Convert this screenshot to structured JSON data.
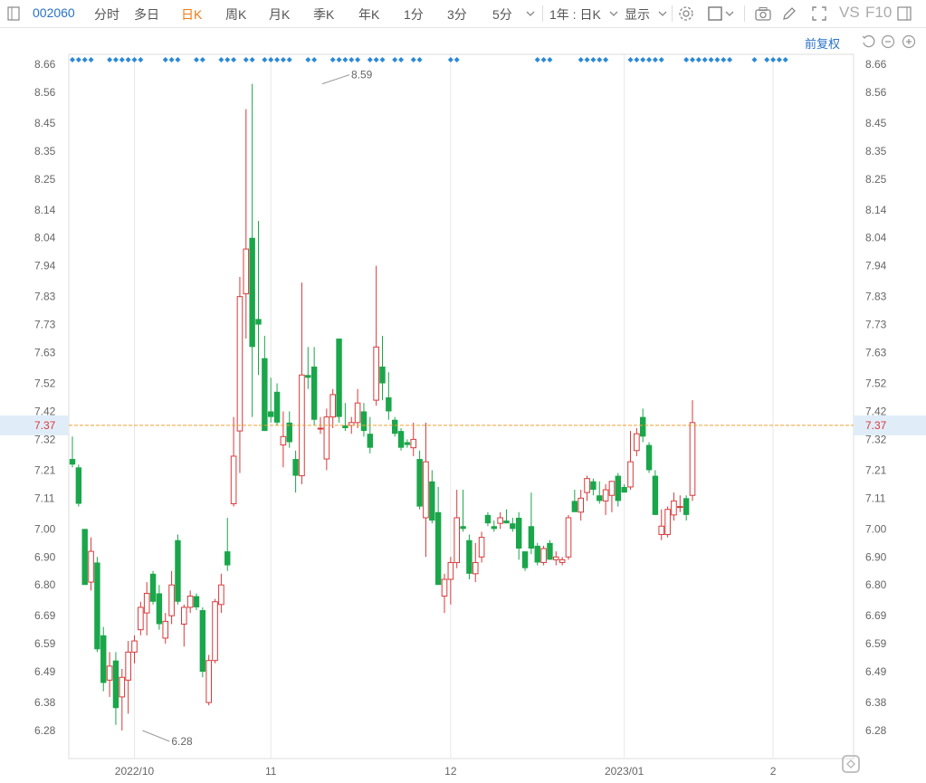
{
  "toolbar": {
    "code": "002060",
    "tabs": [
      "分时",
      "多日",
      "日K",
      "周K",
      "月K",
      "季K",
      "年K",
      "1分",
      "3分",
      "5分"
    ],
    "active_tab": "日K",
    "period_select": "1年 : 日K",
    "display_select": "显示",
    "vs_label": "VS",
    "f10_label": "F10"
  },
  "fuquan_label": "前复权",
  "current_price_label": "7.37",
  "colors": {
    "up": "#d9393a",
    "down": "#1aa64a",
    "price_line": "#f0a030",
    "marker": "#2a88d8",
    "grid": "#e8e8e8"
  },
  "chart_data": {
    "type": "candlestick",
    "y_ticks": [
      "8.66",
      "8.56",
      "8.45",
      "8.35",
      "8.25",
      "8.14",
      "8.04",
      "7.94",
      "7.83",
      "7.73",
      "7.63",
      "7.52",
      "7.42",
      "7.32",
      "7.21",
      "7.11",
      "7.00",
      "6.90",
      "6.80",
      "6.69",
      "6.59",
      "6.49",
      "6.38",
      "6.28"
    ],
    "ylim": [
      6.28,
      8.66
    ],
    "x_labels": [
      {
        "label": "2022/10",
        "index": 10
      },
      {
        "label": "11",
        "index": 32
      },
      {
        "label": "12",
        "index": 61
      },
      {
        "label": "2023/01",
        "index": 89
      },
      {
        "label": "2",
        "index": 113
      }
    ],
    "current_price": 7.37,
    "annotations": [
      {
        "text": "8.59",
        "index": 40,
        "value": 8.59
      },
      {
        "text": "6.28",
        "index": 11,
        "value": 6.28
      }
    ],
    "candles": [
      {
        "o": 7.25,
        "h": 7.33,
        "l": 7.22,
        "c": 7.23
      },
      {
        "o": 7.22,
        "h": 7.23,
        "l": 7.08,
        "c": 7.09
      },
      {
        "o": 7.0,
        "h": 7.0,
        "l": 6.8,
        "c": 6.8
      },
      {
        "o": 6.81,
        "h": 6.97,
        "l": 6.78,
        "c": 6.92
      },
      {
        "o": 6.88,
        "h": 6.9,
        "l": 6.56,
        "c": 6.57
      },
      {
        "o": 6.62,
        "h": 6.65,
        "l": 6.42,
        "c": 6.45
      },
      {
        "o": 6.46,
        "h": 6.56,
        "l": 6.4,
        "c": 6.51
      },
      {
        "o": 6.53,
        "h": 6.56,
        "l": 6.3,
        "c": 6.36
      },
      {
        "o": 6.4,
        "h": 6.5,
        "l": 6.28,
        "c": 6.47
      },
      {
        "o": 6.46,
        "h": 6.6,
        "l": 6.34,
        "c": 6.56
      },
      {
        "o": 6.56,
        "h": 6.62,
        "l": 6.52,
        "c": 6.6
      },
      {
        "o": 6.64,
        "h": 6.74,
        "l": 6.62,
        "c": 6.72
      },
      {
        "o": 6.7,
        "h": 6.81,
        "l": 6.62,
        "c": 6.77
      },
      {
        "o": 6.84,
        "h": 6.85,
        "l": 6.73,
        "c": 6.74
      },
      {
        "o": 6.77,
        "h": 6.8,
        "l": 6.64,
        "c": 6.66
      },
      {
        "o": 6.61,
        "h": 6.7,
        "l": 6.59,
        "c": 6.67
      },
      {
        "o": 6.69,
        "h": 6.85,
        "l": 6.66,
        "c": 6.8
      },
      {
        "o": 6.96,
        "h": 6.98,
        "l": 6.73,
        "c": 6.74
      },
      {
        "o": 6.66,
        "h": 6.73,
        "l": 6.58,
        "c": 6.72
      },
      {
        "o": 6.72,
        "h": 6.78,
        "l": 6.7,
        "c": 6.76
      },
      {
        "o": 6.76,
        "h": 6.77,
        "l": 6.71,
        "c": 6.72
      },
      {
        "o": 6.71,
        "h": 6.72,
        "l": 6.47,
        "c": 6.49
      },
      {
        "o": 6.38,
        "h": 6.55,
        "l": 6.37,
        "c": 6.53
      },
      {
        "o": 6.53,
        "h": 6.75,
        "l": 6.52,
        "c": 6.74
      },
      {
        "o": 6.73,
        "h": 6.84,
        "l": 6.7,
        "c": 6.8
      },
      {
        "o": 6.92,
        "h": 7.04,
        "l": 6.85,
        "c": 6.87
      },
      {
        "o": 7.09,
        "h": 7.4,
        "l": 7.08,
        "c": 7.26
      },
      {
        "o": 7.35,
        "h": 7.9,
        "l": 7.2,
        "c": 7.83
      },
      {
        "o": 7.84,
        "h": 8.5,
        "l": 7.68,
        "c": 8.0
      },
      {
        "o": 8.04,
        "h": 8.59,
        "l": 7.4,
        "c": 7.65
      },
      {
        "o": 7.75,
        "h": 8.1,
        "l": 7.55,
        "c": 7.73
      },
      {
        "o": 7.61,
        "h": 7.69,
        "l": 7.35,
        "c": 7.35
      },
      {
        "o": 7.42,
        "h": 7.54,
        "l": 7.38,
        "c": 7.4
      },
      {
        "o": 7.49,
        "h": 7.52,
        "l": 7.37,
        "c": 7.38
      },
      {
        "o": 7.3,
        "h": 7.42,
        "l": 7.22,
        "c": 7.33
      },
      {
        "o": 7.38,
        "h": 7.42,
        "l": 7.29,
        "c": 7.31
      },
      {
        "o": 7.25,
        "h": 7.28,
        "l": 7.13,
        "c": 7.19
      },
      {
        "o": 7.19,
        "h": 7.88,
        "l": 7.16,
        "c": 7.55
      },
      {
        "o": 7.55,
        "h": 7.65,
        "l": 7.5,
        "c": 7.54
      },
      {
        "o": 7.58,
        "h": 7.65,
        "l": 7.37,
        "c": 7.39
      },
      {
        "o": 7.36,
        "h": 7.4,
        "l": 7.34,
        "c": 7.36
      },
      {
        "o": 7.25,
        "h": 7.43,
        "l": 7.21,
        "c": 7.4
      },
      {
        "o": 7.4,
        "h": 7.5,
        "l": 7.36,
        "c": 7.48
      },
      {
        "o": 7.68,
        "h": 7.68,
        "l": 7.38,
        "c": 7.4
      },
      {
        "o": 7.37,
        "h": 7.45,
        "l": 7.35,
        "c": 7.36
      },
      {
        "o": 7.37,
        "h": 7.4,
        "l": 7.34,
        "c": 7.38
      },
      {
        "o": 7.38,
        "h": 7.5,
        "l": 7.36,
        "c": 7.45
      },
      {
        "o": 7.42,
        "h": 7.45,
        "l": 7.33,
        "c": 7.35
      },
      {
        "o": 7.34,
        "h": 7.4,
        "l": 7.27,
        "c": 7.29
      },
      {
        "o": 7.46,
        "h": 7.94,
        "l": 7.44,
        "c": 7.65
      },
      {
        "o": 7.58,
        "h": 7.69,
        "l": 7.46,
        "c": 7.52
      },
      {
        "o": 7.47,
        "h": 7.56,
        "l": 7.39,
        "c": 7.42
      },
      {
        "o": 7.39,
        "h": 7.4,
        "l": 7.33,
        "c": 7.34
      },
      {
        "o": 7.35,
        "h": 7.36,
        "l": 7.28,
        "c": 7.29
      },
      {
        "o": 7.31,
        "h": 7.32,
        "l": 7.29,
        "c": 7.3
      },
      {
        "o": 7.29,
        "h": 7.38,
        "l": 7.26,
        "c": 7.32
      },
      {
        "o": 7.25,
        "h": 7.28,
        "l": 7.07,
        "c": 7.08
      },
      {
        "o": 7.04,
        "h": 7.38,
        "l": 6.9,
        "c": 7.24
      },
      {
        "o": 7.17,
        "h": 7.21,
        "l": 7.02,
        "c": 7.03
      },
      {
        "o": 7.06,
        "h": 7.15,
        "l": 6.8,
        "c": 6.8
      },
      {
        "o": 6.76,
        "h": 6.84,
        "l": 6.7,
        "c": 6.82
      },
      {
        "o": 6.82,
        "h": 6.9,
        "l": 6.73,
        "c": 6.88
      },
      {
        "o": 6.88,
        "h": 7.14,
        "l": 6.86,
        "c": 7.04
      },
      {
        "o": 7.01,
        "h": 7.14,
        "l": 6.99,
        "c": 7.0
      },
      {
        "o": 6.96,
        "h": 6.98,
        "l": 6.82,
        "c": 6.84
      },
      {
        "o": 6.84,
        "h": 6.95,
        "l": 6.81,
        "c": 6.88
      },
      {
        "o": 6.9,
        "h": 6.99,
        "l": 6.88,
        "c": 6.97
      },
      {
        "o": 7.05,
        "h": 7.06,
        "l": 7.01,
        "c": 7.02
      },
      {
        "o": 7.01,
        "h": 7.03,
        "l": 6.99,
        "c": 7.0
      },
      {
        "o": 7.02,
        "h": 7.06,
        "l": 7.0,
        "c": 7.04
      },
      {
        "o": 7.03,
        "h": 7.07,
        "l": 7.02,
        "c": 7.02
      },
      {
        "o": 7.02,
        "h": 7.04,
        "l": 6.99,
        "c": 7.0
      },
      {
        "o": 7.04,
        "h": 7.06,
        "l": 6.89,
        "c": 6.93
      },
      {
        "o": 6.92,
        "h": 6.92,
        "l": 6.85,
        "c": 6.86
      },
      {
        "o": 7.01,
        "h": 7.13,
        "l": 6.91,
        "c": 6.93
      },
      {
        "o": 6.94,
        "h": 6.95,
        "l": 6.87,
        "c": 6.88
      },
      {
        "o": 6.88,
        "h": 6.94,
        "l": 6.87,
        "c": 6.93
      },
      {
        "o": 6.95,
        "h": 6.96,
        "l": 6.89,
        "c": 6.89
      },
      {
        "o": 6.89,
        "h": 6.92,
        "l": 6.87,
        "c": 6.9
      },
      {
        "o": 6.88,
        "h": 6.9,
        "l": 6.87,
        "c": 6.89
      },
      {
        "o": 6.9,
        "h": 7.05,
        "l": 6.89,
        "c": 7.04
      },
      {
        "o": 7.1,
        "h": 7.14,
        "l": 7.07,
        "c": 7.06
      },
      {
        "o": 7.06,
        "h": 7.14,
        "l": 7.03,
        "c": 7.11
      },
      {
        "o": 7.13,
        "h": 7.19,
        "l": 7.1,
        "c": 7.18
      },
      {
        "o": 7.17,
        "h": 7.18,
        "l": 7.12,
        "c": 7.14
      },
      {
        "o": 7.12,
        "h": 7.17,
        "l": 7.09,
        "c": 7.1
      },
      {
        "o": 7.1,
        "h": 7.16,
        "l": 7.05,
        "c": 7.14
      },
      {
        "o": 7.12,
        "h": 7.17,
        "l": 7.06,
        "c": 7.17
      },
      {
        "o": 7.19,
        "h": 7.2,
        "l": 7.08,
        "c": 7.1
      },
      {
        "o": 7.15,
        "h": 7.16,
        "l": 7.13,
        "c": 7.13
      },
      {
        "o": 7.15,
        "h": 7.35,
        "l": 7.14,
        "c": 7.24
      },
      {
        "o": 7.28,
        "h": 7.36,
        "l": 7.26,
        "c": 7.34
      },
      {
        "o": 7.4,
        "h": 7.43,
        "l": 7.31,
        "c": 7.33
      },
      {
        "o": 7.3,
        "h": 7.31,
        "l": 7.2,
        "c": 7.21
      },
      {
        "o": 7.19,
        "h": 7.21,
        "l": 7.05,
        "c": 7.05
      },
      {
        "o": 6.98,
        "h": 7.07,
        "l": 6.96,
        "c": 7.01
      },
      {
        "o": 6.98,
        "h": 7.08,
        "l": 6.97,
        "c": 7.07
      },
      {
        "o": 7.05,
        "h": 7.13,
        "l": 7.03,
        "c": 7.1
      },
      {
        "o": 7.08,
        "h": 7.12,
        "l": 7.06,
        "c": 7.08
      },
      {
        "o": 7.11,
        "h": 7.12,
        "l": 7.03,
        "c": 7.05
      },
      {
        "o": 7.12,
        "h": 7.46,
        "l": 7.1,
        "c": 7.38
      }
    ],
    "marker_rows": [
      "0-3",
      "6-11",
      "15-17",
      "20-21",
      "24-26",
      "28-29",
      "31-35",
      "38-39",
      "42-46",
      "48-50",
      "52-53",
      "55-56",
      "61-62",
      "75-77",
      "82-86",
      "90-95",
      "99-106",
      "110",
      "112-115"
    ]
  }
}
